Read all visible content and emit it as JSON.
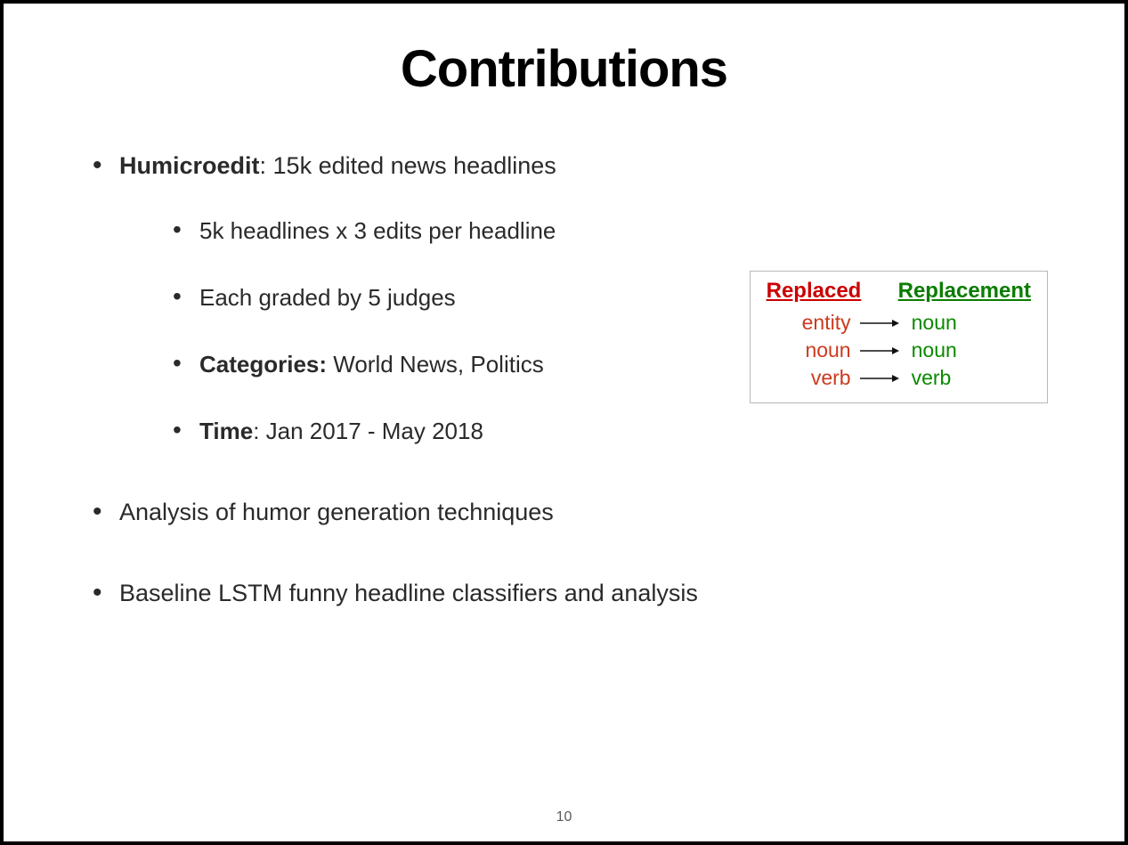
{
  "slide": {
    "title": "Contributions",
    "page_number": "10",
    "bullets": [
      {
        "bold_prefix": "Humicroedit",
        "rest": ": 15k edited news headlines",
        "sub": [
          {
            "text": "5k headlines   x   3 edits per headline"
          },
          {
            "text": "Each graded by 5 judges"
          },
          {
            "bold_prefix": "Categories:",
            "rest": "  World News, Politics"
          },
          {
            "bold_prefix": "Time",
            "rest": ":  Jan 2017 - May 2018"
          }
        ]
      },
      {
        "text": "Analysis of humor generation techniques"
      },
      {
        "text": "Baseline LSTM funny headline classifiers and analysis"
      }
    ],
    "table": {
      "header_replaced": "Replaced",
      "header_replacement": "Replacement",
      "rows": [
        {
          "replaced": "entity",
          "replacement": "noun"
        },
        {
          "replaced": "noun",
          "replacement": "noun"
        },
        {
          "replaced": "verb",
          "replacement": "verb"
        }
      ]
    }
  }
}
